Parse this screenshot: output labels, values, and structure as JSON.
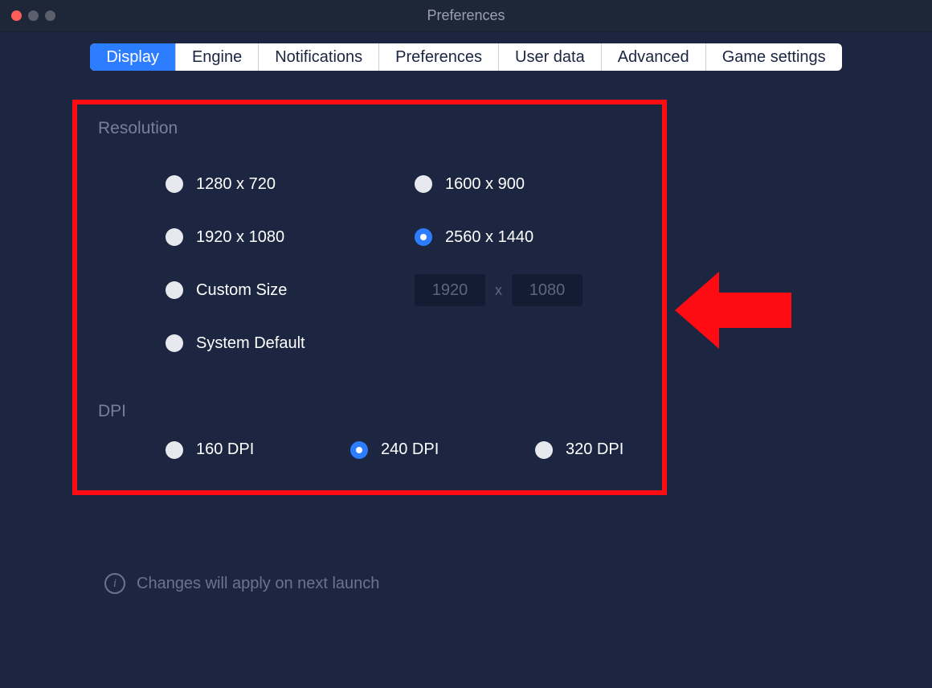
{
  "window": {
    "title": "Preferences"
  },
  "tabs": {
    "items": [
      {
        "label": "Display",
        "active": true
      },
      {
        "label": "Engine",
        "active": false
      },
      {
        "label": "Notifications",
        "active": false
      },
      {
        "label": "Preferences",
        "active": false
      },
      {
        "label": "User data",
        "active": false
      },
      {
        "label": "Advanced",
        "active": false
      },
      {
        "label": "Game settings",
        "active": false
      }
    ]
  },
  "sections": {
    "resolution": {
      "heading": "Resolution",
      "options": [
        {
          "label": "1280 x 720",
          "selected": false
        },
        {
          "label": "1600 x 900",
          "selected": false
        },
        {
          "label": "1920 x 1080",
          "selected": false
        },
        {
          "label": "2560 x 1440",
          "selected": true
        },
        {
          "label": "Custom Size",
          "selected": false
        },
        {
          "label": "System Default",
          "selected": false
        }
      ],
      "custom": {
        "width": "1920",
        "height": "1080",
        "separator": "x"
      }
    },
    "dpi": {
      "heading": "DPI",
      "options": [
        {
          "label": "160 DPI",
          "selected": false
        },
        {
          "label": "240 DPI",
          "selected": true
        },
        {
          "label": "320 DPI",
          "selected": false
        }
      ]
    }
  },
  "footer": {
    "note": "Changes will apply on next launch"
  },
  "annotation": {
    "highlight_color": "#ff0b14",
    "arrow_direction": "left"
  }
}
